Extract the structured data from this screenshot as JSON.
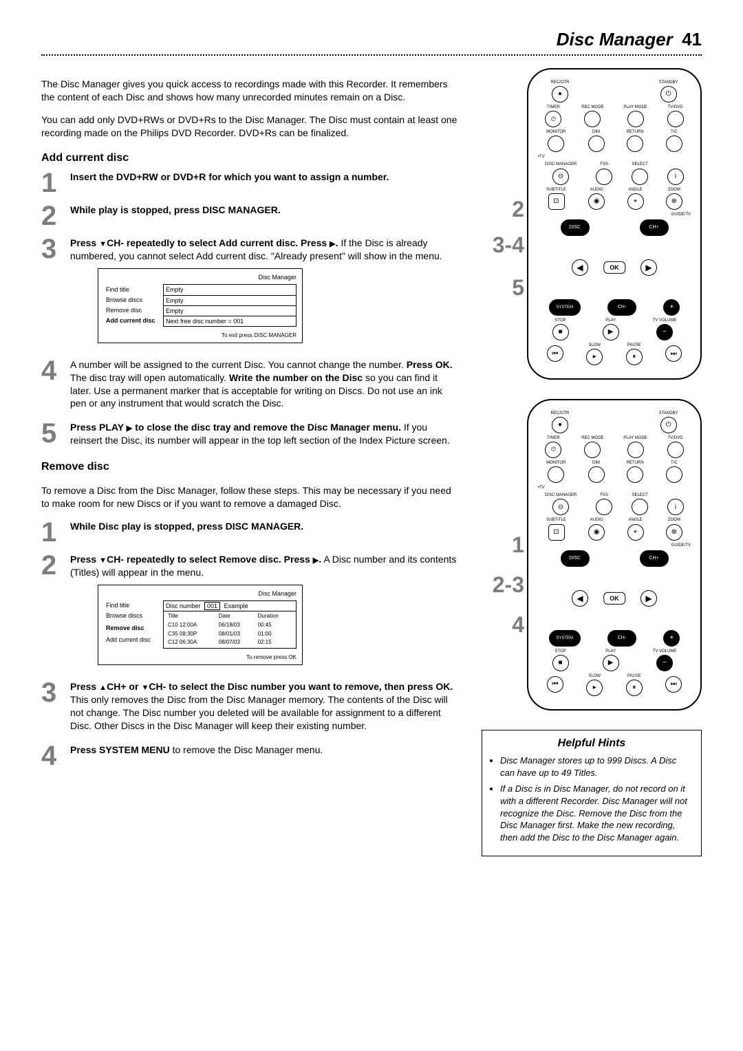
{
  "page": {
    "title": "Disc Manager",
    "number": "41"
  },
  "intro": {
    "p1": "The Disc Manager gives you quick access to recordings made with this Recorder. It remembers the content of each Disc and shows how many unrecorded minutes remain on a Disc.",
    "p2": "You can add only DVD+RWs or DVD+Rs to the Disc Manager. The Disc must contain at least one recording made on the Philips DVD Recorder. DVD+Rs can be finalized."
  },
  "sectionA": {
    "heading": "Add current disc",
    "steps": {
      "s1": {
        "num": "1",
        "bold": "Insert the DVD+RW or DVD+R for which you want to assign a number."
      },
      "s2": {
        "num": "2",
        "bold": "While play is stopped, press DISC MANAGER."
      },
      "s3": {
        "num": "3",
        "bold_a": "Press ",
        "bold_b": "CH- repeatedly to select Add current disc. Press ",
        "bold_c": ".",
        "rest": "If the Disc is already numbered, you cannot select Add current disc. \"Already present\" will show in the menu."
      },
      "s4": {
        "num": "4",
        "text_a": "A number will be assigned to the current Disc. You cannot change the number. ",
        "bold_ok": "Press OK.",
        "text_b": " The disc tray will open automatically. ",
        "bold_write": "Write the number on the Disc",
        "text_c": " so you can find it later. Use a permanent marker that is acceptable for writing on Discs. Do not use an ink pen or any instrument that would scratch the Disc."
      },
      "s5": {
        "num": "5",
        "bold_a": "Press PLAY ",
        "bold_b": " to close the disc tray and remove the Disc Manager menu.",
        "rest": " If you reinsert the Disc, its number will appear in the top left section of the Index Picture screen."
      }
    },
    "screen": {
      "title": "Disc Manager",
      "rows": {
        "r1": {
          "lab": "Find title",
          "val": "Empty"
        },
        "r2": {
          "lab": "Browse discs",
          "val": "Empty"
        },
        "r3": {
          "lab": "Remove disc",
          "val": "Empty"
        },
        "r4": {
          "lab": "Add current disc",
          "val": "Next free disc number = 001"
        }
      },
      "footer": "To exit press DISC MANAGER"
    }
  },
  "sectionB": {
    "heading": "Remove disc",
    "intro": "To remove a Disc from the Disc Manager, follow these steps. This may be necessary if you need to make room for new Discs or if you want to remove a damaged Disc.",
    "steps": {
      "s1": {
        "num": "1",
        "bold": "While Disc play is stopped, press DISC MANAGER."
      },
      "s2": {
        "num": "2",
        "bold_a": "Press ",
        "bold_b": "CH- repeatedly to select Remove disc. Press ",
        "bold_c": ".",
        "rest": " A Disc number and its contents (Titles) will appear in the menu."
      },
      "s3": {
        "num": "3",
        "bold_a": "Press ",
        "bold_b": "CH+ or ",
        "bold_c": "CH- to select the Disc number you want to remove, then press OK.",
        "rest": " This only removes the Disc from the Disc Manager memory. The contents of the Disc will not change. The Disc number you deleted will be available for assignment to a different Disc. Other Discs in the Disc Manager will keep their existing number."
      },
      "s4": {
        "num": "4",
        "bold": "Press SYSTEM MENU",
        "rest": " to remove the Disc Manager menu."
      }
    },
    "screen": {
      "title": "Disc Manager",
      "header": {
        "discnum_lab": "Disc number",
        "discnum_val": "001",
        "example": "Example"
      },
      "cols": {
        "c1": "Title",
        "c2": "Date",
        "c3": "Duration"
      },
      "rows": {
        "r1": {
          "c1": "C10 12:00A",
          "c2": "06/18/03",
          "c3": "00:45"
        },
        "r2": {
          "c1": "C35 08:30P",
          "c2": "08/01/03",
          "c3": "01:00"
        },
        "r3": {
          "c1": "C12 06:30A",
          "c2": "08/07/03",
          "c3": "02:15"
        }
      },
      "left": {
        "l1": "Find title",
        "l2": "Browse discs",
        "l3": "Remove disc",
        "l4": "Add current disc"
      },
      "footer": "To remove press OK"
    }
  },
  "remote": {
    "labels": {
      "rec_otr": "REC/OTR",
      "standby": "STANDBY",
      "timer": "TIMER",
      "rec_mode": "REC MODE",
      "play_mode": "PLAY MODE",
      "tv_dvd": "TV/DVD",
      "monitor": "MONITOR",
      "dim": "DIM",
      "return": "RETURN",
      "tc": "T/C",
      "disc_manager": "DISC MANAGER",
      "fss": "FSS",
      "select": "SELECT",
      "subtitle": "SUBTITLE",
      "audio": "AUDIO",
      "angle": "ANGLE",
      "zoom": "ZOOM",
      "guide_tv": "GUIDE/TV",
      "disc": "DISC",
      "ch_plus": "CH+",
      "ch_minus": "CH-",
      "ok": "OK",
      "system": "SYSTEM",
      "tv": "•TV",
      "stop": "STOP",
      "play": "PLAY",
      "tv_volume": "TV VOLUME",
      "slow": "SLOW",
      "pause": "PAUSE"
    },
    "callouts_top": {
      "a": "2",
      "b": "3-4",
      "c": "5"
    },
    "callouts_bot": {
      "a": "1",
      "b": "2-3",
      "c": "4"
    }
  },
  "hints": {
    "title": "Helpful Hints",
    "items": {
      "h1": "Disc Manager stores up to 999 Discs. A Disc can have up to 49 Titles.",
      "h2": "If a Disc is in Disc Manager, do not record on it with a different Recorder. Disc Manager will not recognize the Disc. Remove the Disc from the Disc Manager first. Make the new recording, then add the Disc to the Disc Manager again."
    }
  }
}
